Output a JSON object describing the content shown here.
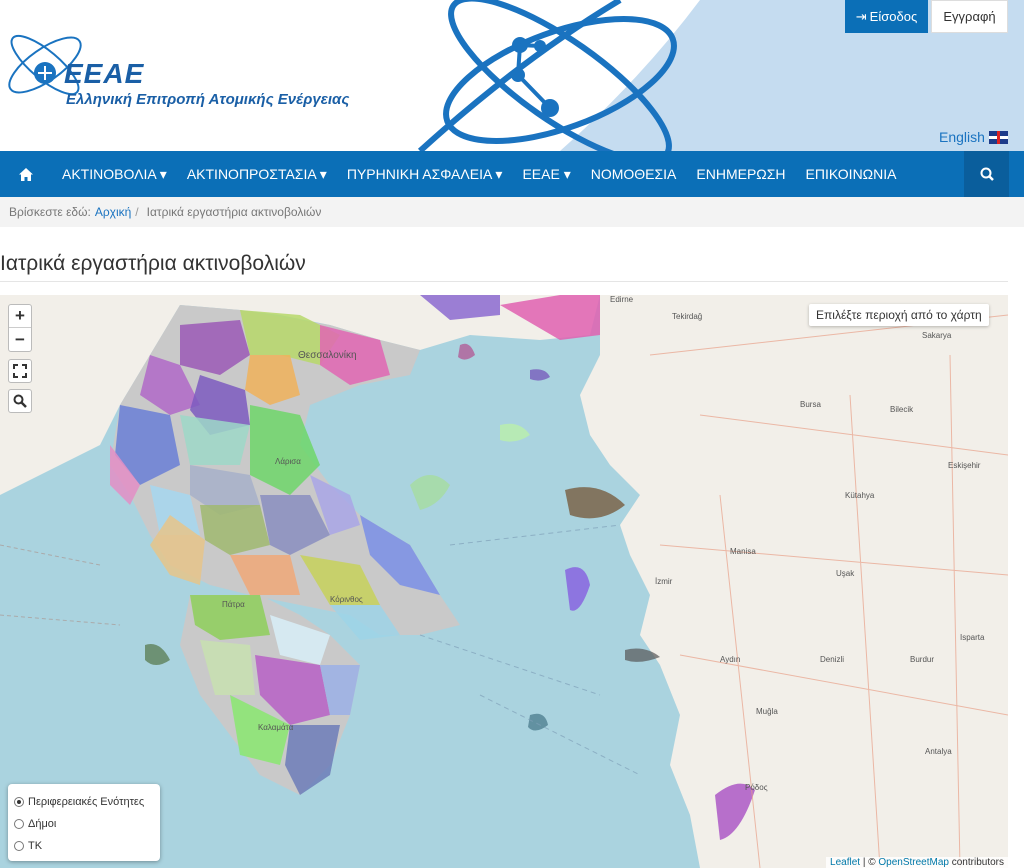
{
  "header": {
    "logo_title": "ΕΕΑΕ",
    "logo_subtitle": "Ελληνική Επιτροπή Ατομικής Ενέργειας",
    "login_label": "Είσοδος",
    "register_label": "Εγγραφή",
    "language_label": "English"
  },
  "nav": {
    "items": [
      {
        "label": "ΑΚΤΙΝΟΒΟΛΙΑ ▾"
      },
      {
        "label": "ΑΚΤΙΝΟΠΡΟΣΤΑΣΙΑ ▾"
      },
      {
        "label": "ΠΥΡΗΝΙΚΗ ΑΣΦΑΛΕΙΑ ▾"
      },
      {
        "label": "ΕΕΑΕ ▾"
      },
      {
        "label": "ΝΟΜΟΘΕΣΙΑ"
      },
      {
        "label": "ΕΝΗΜΕΡΩΣΗ"
      },
      {
        "label": "ΕΠΙΚΟΙΝΩΝΙΑ"
      }
    ]
  },
  "breadcrumb": {
    "prefix": "Βρίσκεστε εδώ:",
    "home": "Αρχική",
    "separator": "/",
    "current": "Ιατρικά εργαστήρια ακτινοβολιών"
  },
  "page": {
    "title": "Ιατρικά εργαστήρια ακτινοβολιών"
  },
  "map": {
    "zoom_in": "+",
    "zoom_out": "−",
    "select_region_label": "Επιλέξτε περιοχή από το χάρτη",
    "layers": [
      {
        "label": "Περιφερειακές Ενότητες",
        "selected": true
      },
      {
        "label": "Δήμοι",
        "selected": false
      },
      {
        "label": "ΤΚ",
        "selected": false
      }
    ],
    "attribution_leaflet": "Leaflet",
    "attribution_sep": " | © ",
    "attribution_osm": "OpenStreetMap",
    "attribution_suffix": " contributors",
    "place_labels": [
      "Θεσσαλονίκη",
      "Λάρισα",
      "Πάτρα",
      "Κόρινθος",
      "Καλαμάτα",
      "Ρόδος",
      "İzmir",
      "Bursa",
      "Kütahya",
      "Manisa",
      "Denizli",
      "Aydın",
      "Burdur",
      "Antalya",
      "Edirne",
      "Tekirdağ",
      "Sakarya",
      "Bilecik",
      "Eskişehir",
      "Uşak",
      "Isparta",
      "Muğla"
    ]
  },
  "colors": {
    "nav_bg": "#0b6fb7",
    "sea": "#aad3df",
    "land_turkey": "#f2efe9"
  }
}
